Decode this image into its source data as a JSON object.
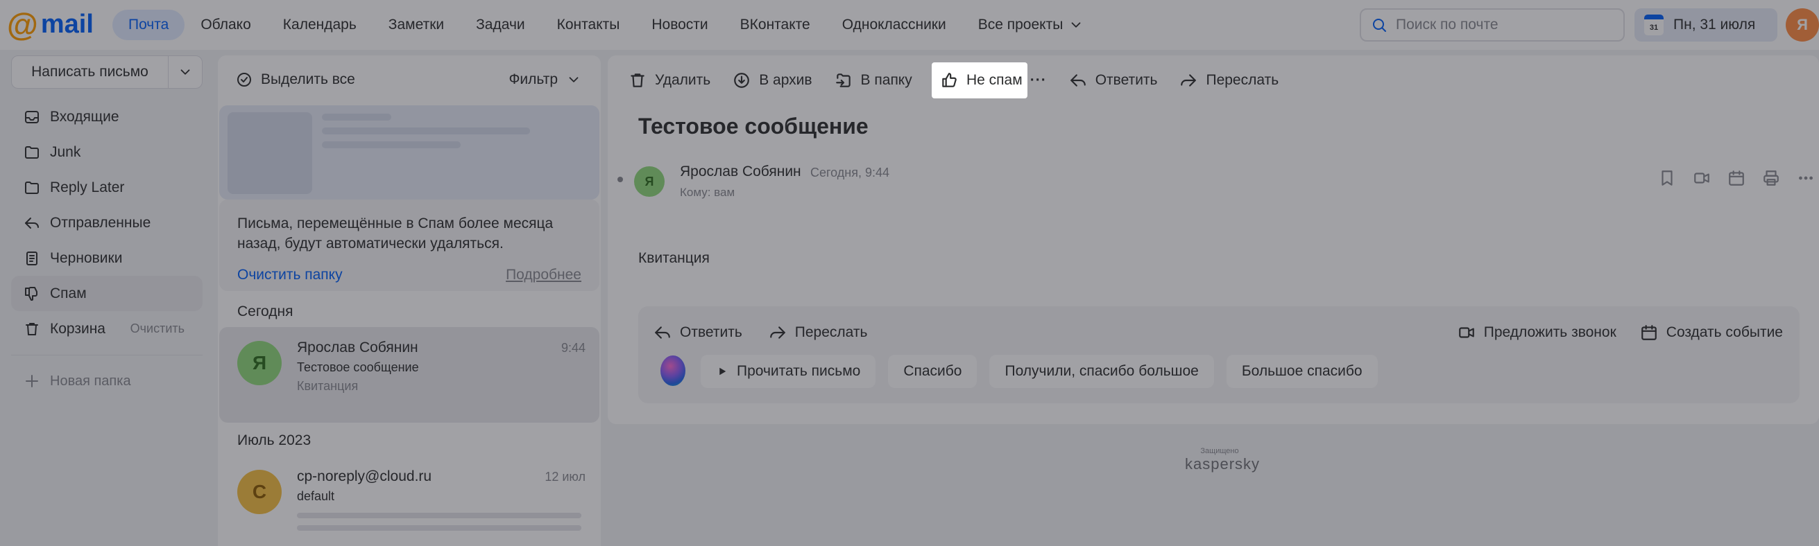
{
  "logo": {
    "at": "@",
    "word": "mail"
  },
  "topnav": [
    {
      "label": "Почта"
    },
    {
      "label": "Облако"
    },
    {
      "label": "Календарь"
    },
    {
      "label": "Заметки"
    },
    {
      "label": "Задачи"
    },
    {
      "label": "Контакты"
    },
    {
      "label": "Новости"
    },
    {
      "label": "ВКонтакте"
    },
    {
      "label": "Одноклассники"
    },
    {
      "label": "Все проекты"
    }
  ],
  "search": {
    "placeholder": "Поиск по почте",
    "value": ""
  },
  "date_chip": {
    "day": "31",
    "label": "Пн, 31 июля"
  },
  "user": {
    "initial": "Я"
  },
  "compose": {
    "label": "Написать письмо"
  },
  "folders": [
    {
      "label": "Входящие",
      "icon": "inbox-icon"
    },
    {
      "label": "Junk",
      "icon": "folder-icon"
    },
    {
      "label": "Reply Later",
      "icon": "folder-icon"
    },
    {
      "label": "Отправленные",
      "icon": "sent-icon"
    },
    {
      "label": "Черновики",
      "icon": "drafts-icon"
    },
    {
      "label": "Спам",
      "icon": "spam-icon"
    },
    {
      "label": "Корзина",
      "icon": "trash-icon",
      "aux": "Очистить"
    }
  ],
  "new_folder": {
    "label": "Новая папка"
  },
  "list": {
    "select_all": "Выделить все",
    "filter": "Фильтр",
    "notice": {
      "text": "Письма, перемещённые в Спам более месяца назад, будут автоматически удаляться.",
      "clear": "Очистить папку",
      "more": "Подробнее"
    },
    "groups": {
      "today": "Сегодня",
      "july": "Июль 2023"
    },
    "messages": [
      {
        "initial": "Я",
        "from": "Ярослав Собянин",
        "subject": "Тестовое сообщение",
        "snippet": "Квитанция",
        "time": "9:44",
        "avatar_color": "#90d97a",
        "avatar_text_color": "#2b6b1c"
      },
      {
        "initial": "С",
        "from": "cp-noreply@cloud.ru",
        "subject": "default",
        "snippet": "",
        "time": "12 июл",
        "avatar_color": "#f5c042",
        "avatar_text_color": "#8a5a00"
      }
    ]
  },
  "toolbar": {
    "delete": "Удалить",
    "archive": "В архив",
    "move": "В папку",
    "not_spam": "Не спам",
    "more": "···",
    "reply": "Ответить",
    "forward": "Переслать"
  },
  "message": {
    "subject": "Тестовое сообщение",
    "sender_initial": "Я",
    "sender": "Ярослав Собянин",
    "time": "Сегодня, 9:44",
    "to": "Кому: вам",
    "body": "Квитанция"
  },
  "quick": {
    "reply": "Ответить",
    "forward": "Переслать",
    "suggest_call": "Предложить звонок",
    "create_event": "Создать событие",
    "chips": [
      "Прочитать письмо",
      "Спасибо",
      "Получили, спасибо большое",
      "Большое спасибо"
    ]
  },
  "footer": {
    "small": "Защищено",
    "brand": "kaspersky"
  },
  "colors": {
    "accent": "#005ff9",
    "logo_at": "#ff9e00",
    "dim_overlay": "rgba(30,32,40,0.42)"
  }
}
